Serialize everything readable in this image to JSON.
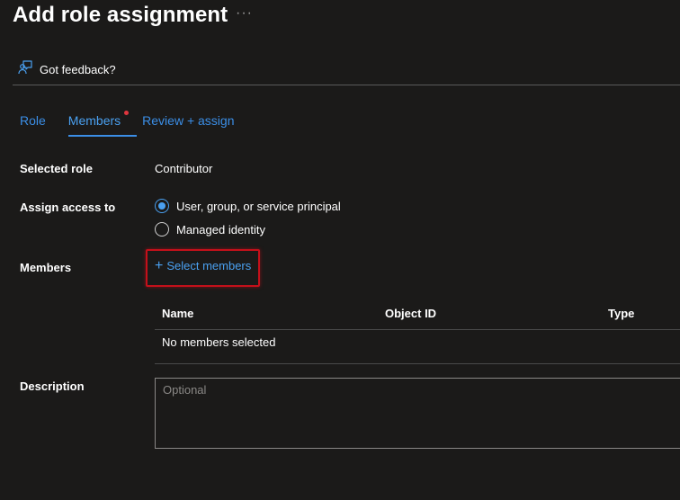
{
  "page": {
    "title": "Add role assignment",
    "more_label": "···"
  },
  "toolbar": {
    "feedback_label": "Got feedback?"
  },
  "tabs": [
    {
      "label": "Role",
      "selected": false
    },
    {
      "label": "Members",
      "selected": true,
      "has_indicator": true
    },
    {
      "label": "Review + assign",
      "selected": false
    }
  ],
  "form": {
    "selected_role_label": "Selected role",
    "selected_role_value": "Contributor",
    "assign_access_label": "Assign access to",
    "assign_options": [
      {
        "label": "User, group, or service principal",
        "checked": true
      },
      {
        "label": "Managed identity",
        "checked": false
      }
    ],
    "members_label": "Members",
    "select_members_label": "Select members",
    "table_headers": [
      "Name",
      "Object ID",
      "Type"
    ],
    "empty_message": "No members selected",
    "description_label": "Description",
    "description_placeholder": "Optional",
    "description_value": ""
  },
  "colors": {
    "background": "#1b1a19",
    "accent": "#4aa0f0",
    "highlight_border": "#c4101a",
    "indicator_dot": "#e0363e"
  },
  "icons": {
    "feedback": "feedback-person-icon",
    "add": "plus-icon",
    "more": "ellipsis-icon"
  }
}
